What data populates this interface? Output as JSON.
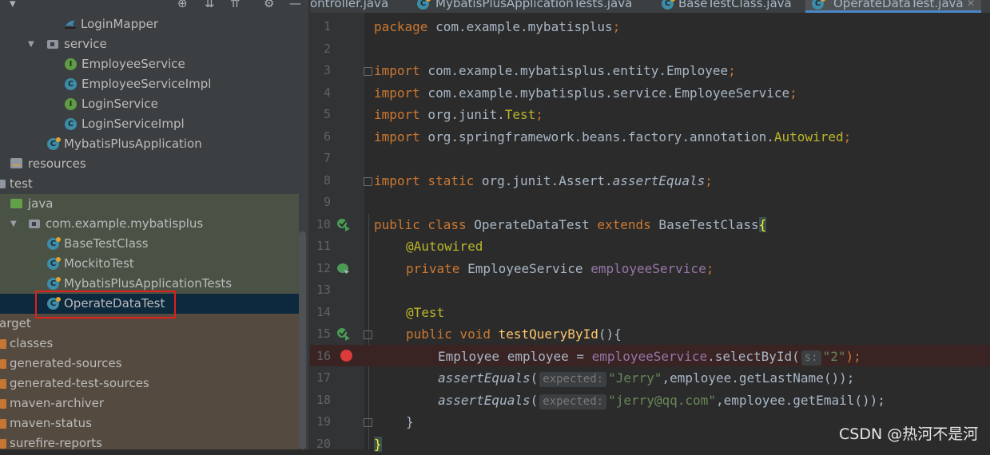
{
  "project_tree": {
    "items": [
      {
        "label": "LoginMapper",
        "icon": "mapper-icon"
      },
      {
        "label": "service",
        "icon": "package-icon"
      },
      {
        "label": "EmployeeService",
        "icon": "interface-icon"
      },
      {
        "label": "EmployeeServiceImpl",
        "icon": "class-icon"
      },
      {
        "label": "LoginService",
        "icon": "interface-icon"
      },
      {
        "label": "LoginServiceImpl",
        "icon": "class-icon"
      },
      {
        "label": "MybatisPlusApplication",
        "icon": "spring-boot-class-icon"
      },
      {
        "label": "resources",
        "icon": "resources-folder-icon"
      },
      {
        "label": "test",
        "icon": "folder-icon"
      },
      {
        "label": "java",
        "icon": "test-source-folder-icon"
      },
      {
        "label": "com.example.mybatisplus",
        "icon": "package-icon"
      },
      {
        "label": "BaseTestClass",
        "icon": "test-class-icon"
      },
      {
        "label": "MockitoTest",
        "icon": "test-class-icon"
      },
      {
        "label": "MybatisPlusApplicationTests",
        "icon": "test-class-icon"
      },
      {
        "label": "OperateDataTest",
        "icon": "test-class-icon",
        "selected": true
      },
      {
        "label": "arget",
        "icon": "excluded-folder-icon"
      },
      {
        "label": "classes",
        "icon": "excluded-folder-icon"
      },
      {
        "label": "generated-sources",
        "icon": "excluded-folder-icon"
      },
      {
        "label": "generated-test-sources",
        "icon": "excluded-folder-icon"
      },
      {
        "label": "maven-archiver",
        "icon": "excluded-folder-icon"
      },
      {
        "label": "maven-status",
        "icon": "excluded-folder-icon"
      },
      {
        "label": "surefire-reports",
        "icon": "excluded-folder-icon"
      }
    ]
  },
  "tabs": [
    {
      "label": "ontroller.java",
      "icon": "class-icon"
    },
    {
      "label": "MybatisPlusApplicationTests.java",
      "icon": "test-class-icon"
    },
    {
      "label": "BaseTestClass.java",
      "icon": "test-class-icon"
    },
    {
      "label": "OperateDataTest.java",
      "icon": "test-class-icon",
      "active": true
    }
  ],
  "editor": {
    "line_numbers": [
      "1",
      "2",
      "3",
      "4",
      "5",
      "6",
      "7",
      "8",
      "9",
      "10",
      "11",
      "12",
      "13",
      "14",
      "15",
      "16",
      "17",
      "18",
      "19",
      "20"
    ],
    "code": {
      "l1_kw": "package",
      "l1_rest": " com.example.mybatisplus",
      "l1_semi": ";",
      "l3_kw": "import",
      "l3_rest": " com.example.mybatisplus.entity.Employee",
      "l3_semi": ";",
      "l4_kw": "import",
      "l4_rest": " com.example.mybatisplus.service.EmployeeService",
      "l4_semi": ";",
      "l5_kw": "import",
      "l5_rest": " org.junit.",
      "l5_ann": "Test",
      "l5_semi": ";",
      "l6_kw": "import",
      "l6_rest": " org.springframework.beans.factory.annotation.",
      "l6_ann": "Autowired",
      "l6_semi": ";",
      "l8_kw": "import static",
      "l8_rest": " org.junit.Assert.",
      "l8_it": "assertEquals",
      "l8_semi": ";",
      "l10_kw1": "public class",
      "l10_name": " OperateDataTest ",
      "l10_kw2": "extends",
      "l10_base": " BaseTestClass",
      "l10_brace": "{",
      "l11_ann": "@Autowired",
      "l12_kw": "private",
      "l12_type": " EmployeeService ",
      "l12_fld": "employeeService",
      "l12_semi": ";",
      "l14_ann": "@Test",
      "l15_kw": "public void",
      "l15_sp": " ",
      "l15_mth": "testQueryById",
      "l15_rest": "(){",
      "l16_pre": "Employee employee = ",
      "l16_fld": "employeeService",
      "l16_call": ".selectById(",
      "l16_hint": "s:",
      "l16_str": "\"2\"",
      "l16_end": ");",
      "l17_it": "assertEquals",
      "l17_open": "(",
      "l17_hint": "expected:",
      "l17_str": "\"Jerry\"",
      "l17_rest": ",employee.getLastName());",
      "l18_it": "assertEquals",
      "l18_open": "(",
      "l18_hint": "expected:",
      "l18_str": "\"jerry@qq.com\"",
      "l18_rest": ",employee.getEmail());",
      "l19": "}",
      "l20": "}"
    }
  },
  "watermark": "CSDN @热河不是河",
  "colors": {
    "keyword": "#cc7832",
    "annotation": "#bbb529",
    "field": "#9876aa",
    "method": "#ffc66d",
    "string": "#6a8759",
    "highlight_box": "#e0201c"
  }
}
